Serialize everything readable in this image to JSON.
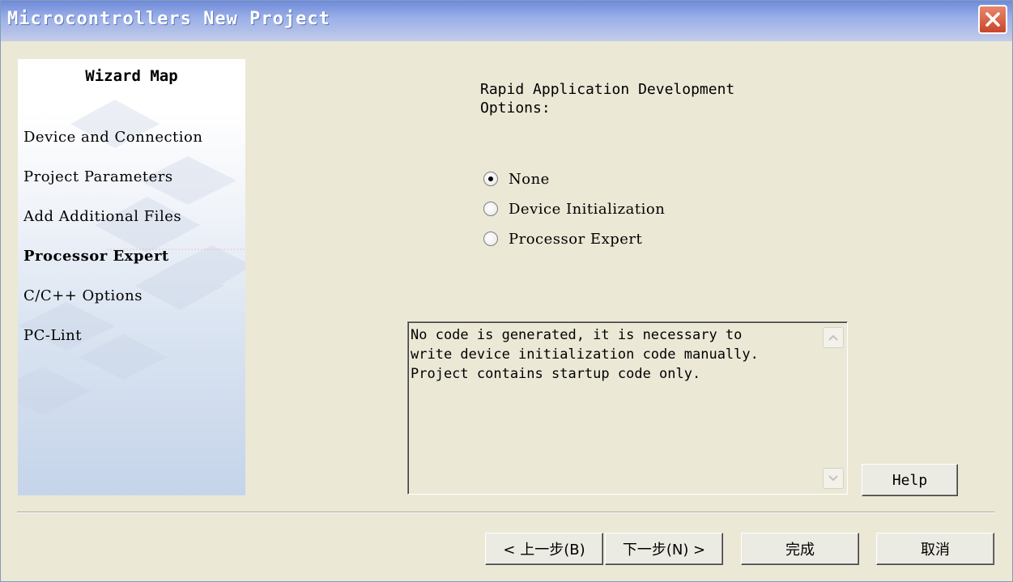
{
  "window": {
    "title": "Microcontrollers New Project"
  },
  "sidebar": {
    "title": "Wizard Map",
    "steps": [
      {
        "label": "Device and Connection",
        "active": false
      },
      {
        "label": "Project Parameters",
        "active": false
      },
      {
        "label": "Add Additional Files",
        "active": false
      },
      {
        "label": "Processor Expert",
        "active": true
      },
      {
        "label": "C/C++ Options",
        "active": false
      },
      {
        "label": "PC-Lint",
        "active": false
      }
    ]
  },
  "main": {
    "options_label": "Rapid Application Development Options:",
    "radios": [
      {
        "label": "None",
        "selected": true
      },
      {
        "label": "Device Initialization",
        "selected": false
      },
      {
        "label": "Processor Expert",
        "selected": false
      }
    ],
    "description": "No code is generated, it is necessary to\nwrite device initialization code manually.\nProject contains startup code only.",
    "help_label": "Help"
  },
  "footer": {
    "back_label": "< 上一步(B)",
    "next_label": "下一步(N) >",
    "finish_label": "完成",
    "cancel_label": "取消"
  },
  "colors": {
    "titlebar_start": "#6f89d8",
    "titlebar_end": "#c4cde9",
    "close_button": "#c9462a",
    "dialog_bg": "#ebe8d6"
  }
}
